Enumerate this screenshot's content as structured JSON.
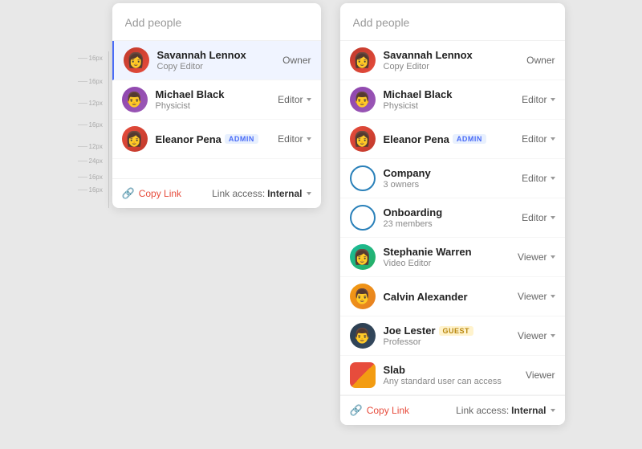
{
  "leftPanel": {
    "header": {
      "placeholder": "Add people"
    },
    "people": [
      {
        "name": "Savannah Lennox",
        "subtitle": "Copy Editor",
        "role": "Owner",
        "hasDropdown": false,
        "avatarType": "savannah",
        "badge": null,
        "selected": true
      },
      {
        "name": "Michael Black",
        "subtitle": "Physicist",
        "role": "Editor",
        "hasDropdown": true,
        "avatarType": "michael",
        "badge": null,
        "selected": false
      },
      {
        "name": "Eleanor Pena",
        "subtitle": "",
        "role": "Editor",
        "hasDropdown": true,
        "avatarType": "eleanor",
        "badge": "ADMIN",
        "selected": false
      }
    ],
    "footer": {
      "copyLink": "Copy Link",
      "linkAccess": "Link access:",
      "accessType": "Internal"
    },
    "spacingLabels": [
      "16px",
      "16px",
      "12px",
      "16px",
      "12px",
      "24px",
      "16px",
      "16px"
    ]
  },
  "rightPanel": {
    "header": {
      "placeholder": "Add people"
    },
    "people": [
      {
        "name": "Savannah Lennox",
        "subtitle": "Copy Editor",
        "role": "Owner",
        "hasDropdown": false,
        "avatarType": "savannah",
        "badge": null,
        "type": "person"
      },
      {
        "name": "Michael Black",
        "subtitle": "Physicist",
        "role": "Editor",
        "hasDropdown": true,
        "avatarType": "michael",
        "badge": null,
        "type": "person"
      },
      {
        "name": "Eleanor Pena",
        "subtitle": "",
        "role": "Editor",
        "hasDropdown": true,
        "avatarType": "eleanor",
        "badge": "ADMIN",
        "type": "person"
      },
      {
        "name": "Company",
        "subtitle": "3 owners",
        "role": "Editor",
        "hasDropdown": true,
        "avatarType": "company",
        "badge": null,
        "type": "group"
      },
      {
        "name": "Onboarding",
        "subtitle": "23 members",
        "role": "Editor",
        "hasDropdown": true,
        "avatarType": "onboarding",
        "badge": null,
        "type": "group"
      },
      {
        "name": "Stephanie Warren",
        "subtitle": "Video Editor",
        "role": "Viewer",
        "hasDropdown": true,
        "avatarType": "stephanie",
        "badge": null,
        "type": "person"
      },
      {
        "name": "Calvin Alexander",
        "subtitle": "",
        "role": "Viewer",
        "hasDropdown": true,
        "avatarType": "calvin",
        "badge": null,
        "type": "person"
      },
      {
        "name": "Joe Lester",
        "subtitle": "Professor",
        "role": "Viewer",
        "hasDropdown": true,
        "avatarType": "joe",
        "badge": "GUEST",
        "type": "person"
      },
      {
        "name": "Slab",
        "subtitle": "Any standard user can access",
        "role": "Viewer",
        "hasDropdown": false,
        "avatarType": "slab",
        "badge": null,
        "type": "app"
      }
    ],
    "footer": {
      "copyLink": "Copy Link",
      "linkAccess": "Link access:",
      "accessType": "Internal"
    }
  },
  "spacing": {
    "s16": "16px",
    "s12": "12px",
    "s24": "24px"
  }
}
